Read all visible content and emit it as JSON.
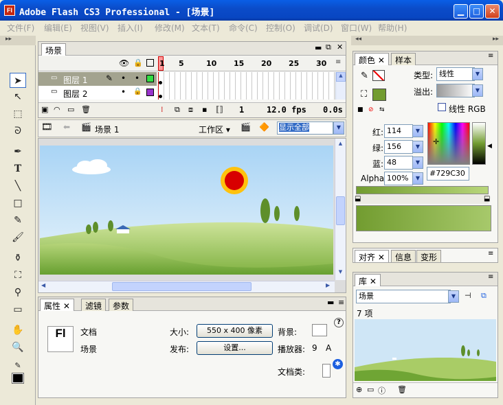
{
  "app": {
    "logo": "Fl",
    "title": "Adobe Flash CS3 Professional - [场景]"
  },
  "menu": [
    "文件(F)",
    "编辑(E)",
    "视图(V)",
    "插入(I)",
    "修改(M)",
    "文本(T)",
    "命令(C)",
    "控制(O)",
    "调试(D)",
    "窗口(W)",
    "帮助(H)"
  ],
  "timeline": {
    "tab": "场景",
    "frame_numbers": [
      "1",
      "5",
      "10",
      "15",
      "20",
      "25",
      "30"
    ],
    "layers": [
      {
        "name": "图层 1",
        "color": "#33dd44",
        "selected": true
      },
      {
        "name": "图层 2",
        "color": "#9933cc",
        "selected": false
      }
    ],
    "current_frame": "1",
    "fps": "12.0 fps",
    "time": "0.0s"
  },
  "editbar": {
    "scene": "场景 1",
    "workspace": "工作区",
    "zoom": "显示全部"
  },
  "properties": {
    "tabs": [
      "属性",
      "滤镜",
      "参数"
    ],
    "doc_logo": "Fl",
    "doc_type": "文档",
    "doc_name": "场景",
    "size_label": "大小:",
    "size_value": "550 x 400 像素",
    "bg_label": "背景:",
    "publish_label": "发布:",
    "settings_button": "设置...",
    "player_label": "播放器:",
    "player_version": "9",
    "player_extra": "A",
    "doc_class_label": "文档类:"
  },
  "color_panel": {
    "tabs": [
      "颜色",
      "样本"
    ],
    "type_label": "类型:",
    "type_value": "线性",
    "overflow_label": "溢出:",
    "linear_rgb": "线性 RGB",
    "red_label": "红:",
    "red": "114",
    "green_label": "绿:",
    "green": "156",
    "blue_label": "蓝:",
    "blue": "48",
    "alpha_label": "Alpha:",
    "alpha": "100%",
    "hex": "#729C30",
    "fill_color": "#729c30"
  },
  "align_panel": {
    "tabs": [
      "对齐",
      "信息",
      "变形"
    ]
  },
  "library": {
    "tab": "库",
    "dropdown": "场景",
    "count": "7 项"
  }
}
